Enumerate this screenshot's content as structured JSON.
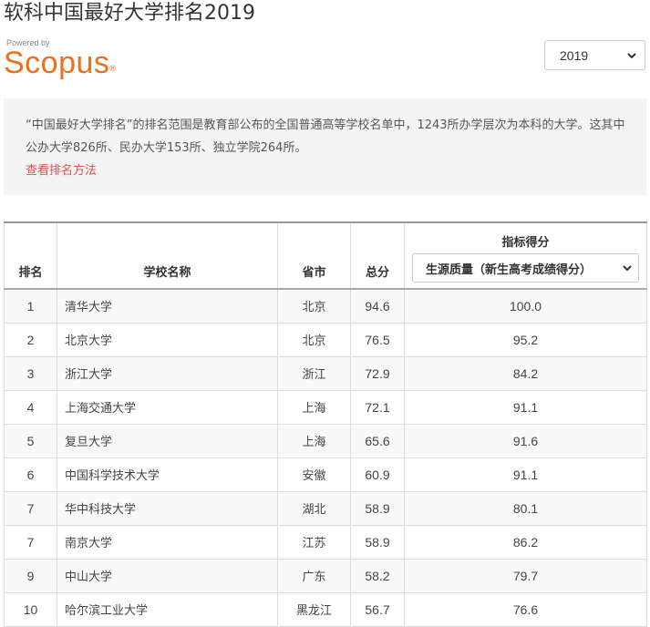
{
  "page": {
    "title": "软科中国最好大学排名2019",
    "powered_by": "Powered by",
    "logo_text": "Scopus",
    "logo_mark": "®",
    "brand_color": "#e9711c",
    "link_color": "#d9534f"
  },
  "year_select": {
    "value": "2019",
    "icon": "chevron-down-icon"
  },
  "info": {
    "text": "“中国最好大学排名”的排名范围是教育部公布的全国普通高等学校名单中，1243所办学层次为本科的大学。这其中公办大学826所、民办大学153所、独立学院264所。",
    "link": "查看排名方法"
  },
  "table": {
    "headers": {
      "rank": "排名",
      "school": "学校名称",
      "province": "省市",
      "score": "总分",
      "indicator": "指标得分"
    },
    "indicator_select": {
      "value": "生源质量（新生高考成绩得分）",
      "icon": "chevron-down-icon"
    },
    "rows": [
      {
        "rank": "1",
        "name": "清华大学",
        "province": "北京",
        "score": "94.6",
        "indicator": "100.0"
      },
      {
        "rank": "2",
        "name": "北京大学",
        "province": "北京",
        "score": "76.5",
        "indicator": "95.2"
      },
      {
        "rank": "3",
        "name": "浙江大学",
        "province": "浙江",
        "score": "72.9",
        "indicator": "84.2"
      },
      {
        "rank": "4",
        "name": "上海交通大学",
        "province": "上海",
        "score": "72.1",
        "indicator": "91.1"
      },
      {
        "rank": "5",
        "name": "复旦大学",
        "province": "上海",
        "score": "65.6",
        "indicator": "91.6"
      },
      {
        "rank": "6",
        "name": "中国科学技术大学",
        "province": "安徽",
        "score": "60.9",
        "indicator": "91.1"
      },
      {
        "rank": "7",
        "name": "华中科技大学",
        "province": "湖北",
        "score": "58.9",
        "indicator": "80.1"
      },
      {
        "rank": "7",
        "name": "南京大学",
        "province": "江苏",
        "score": "58.9",
        "indicator": "86.2"
      },
      {
        "rank": "9",
        "name": "中山大学",
        "province": "广东",
        "score": "58.2",
        "indicator": "79.7"
      },
      {
        "rank": "10",
        "name": "哈尔滨工业大学",
        "province": "黑龙江",
        "score": "56.7",
        "indicator": "76.6"
      }
    ]
  }
}
